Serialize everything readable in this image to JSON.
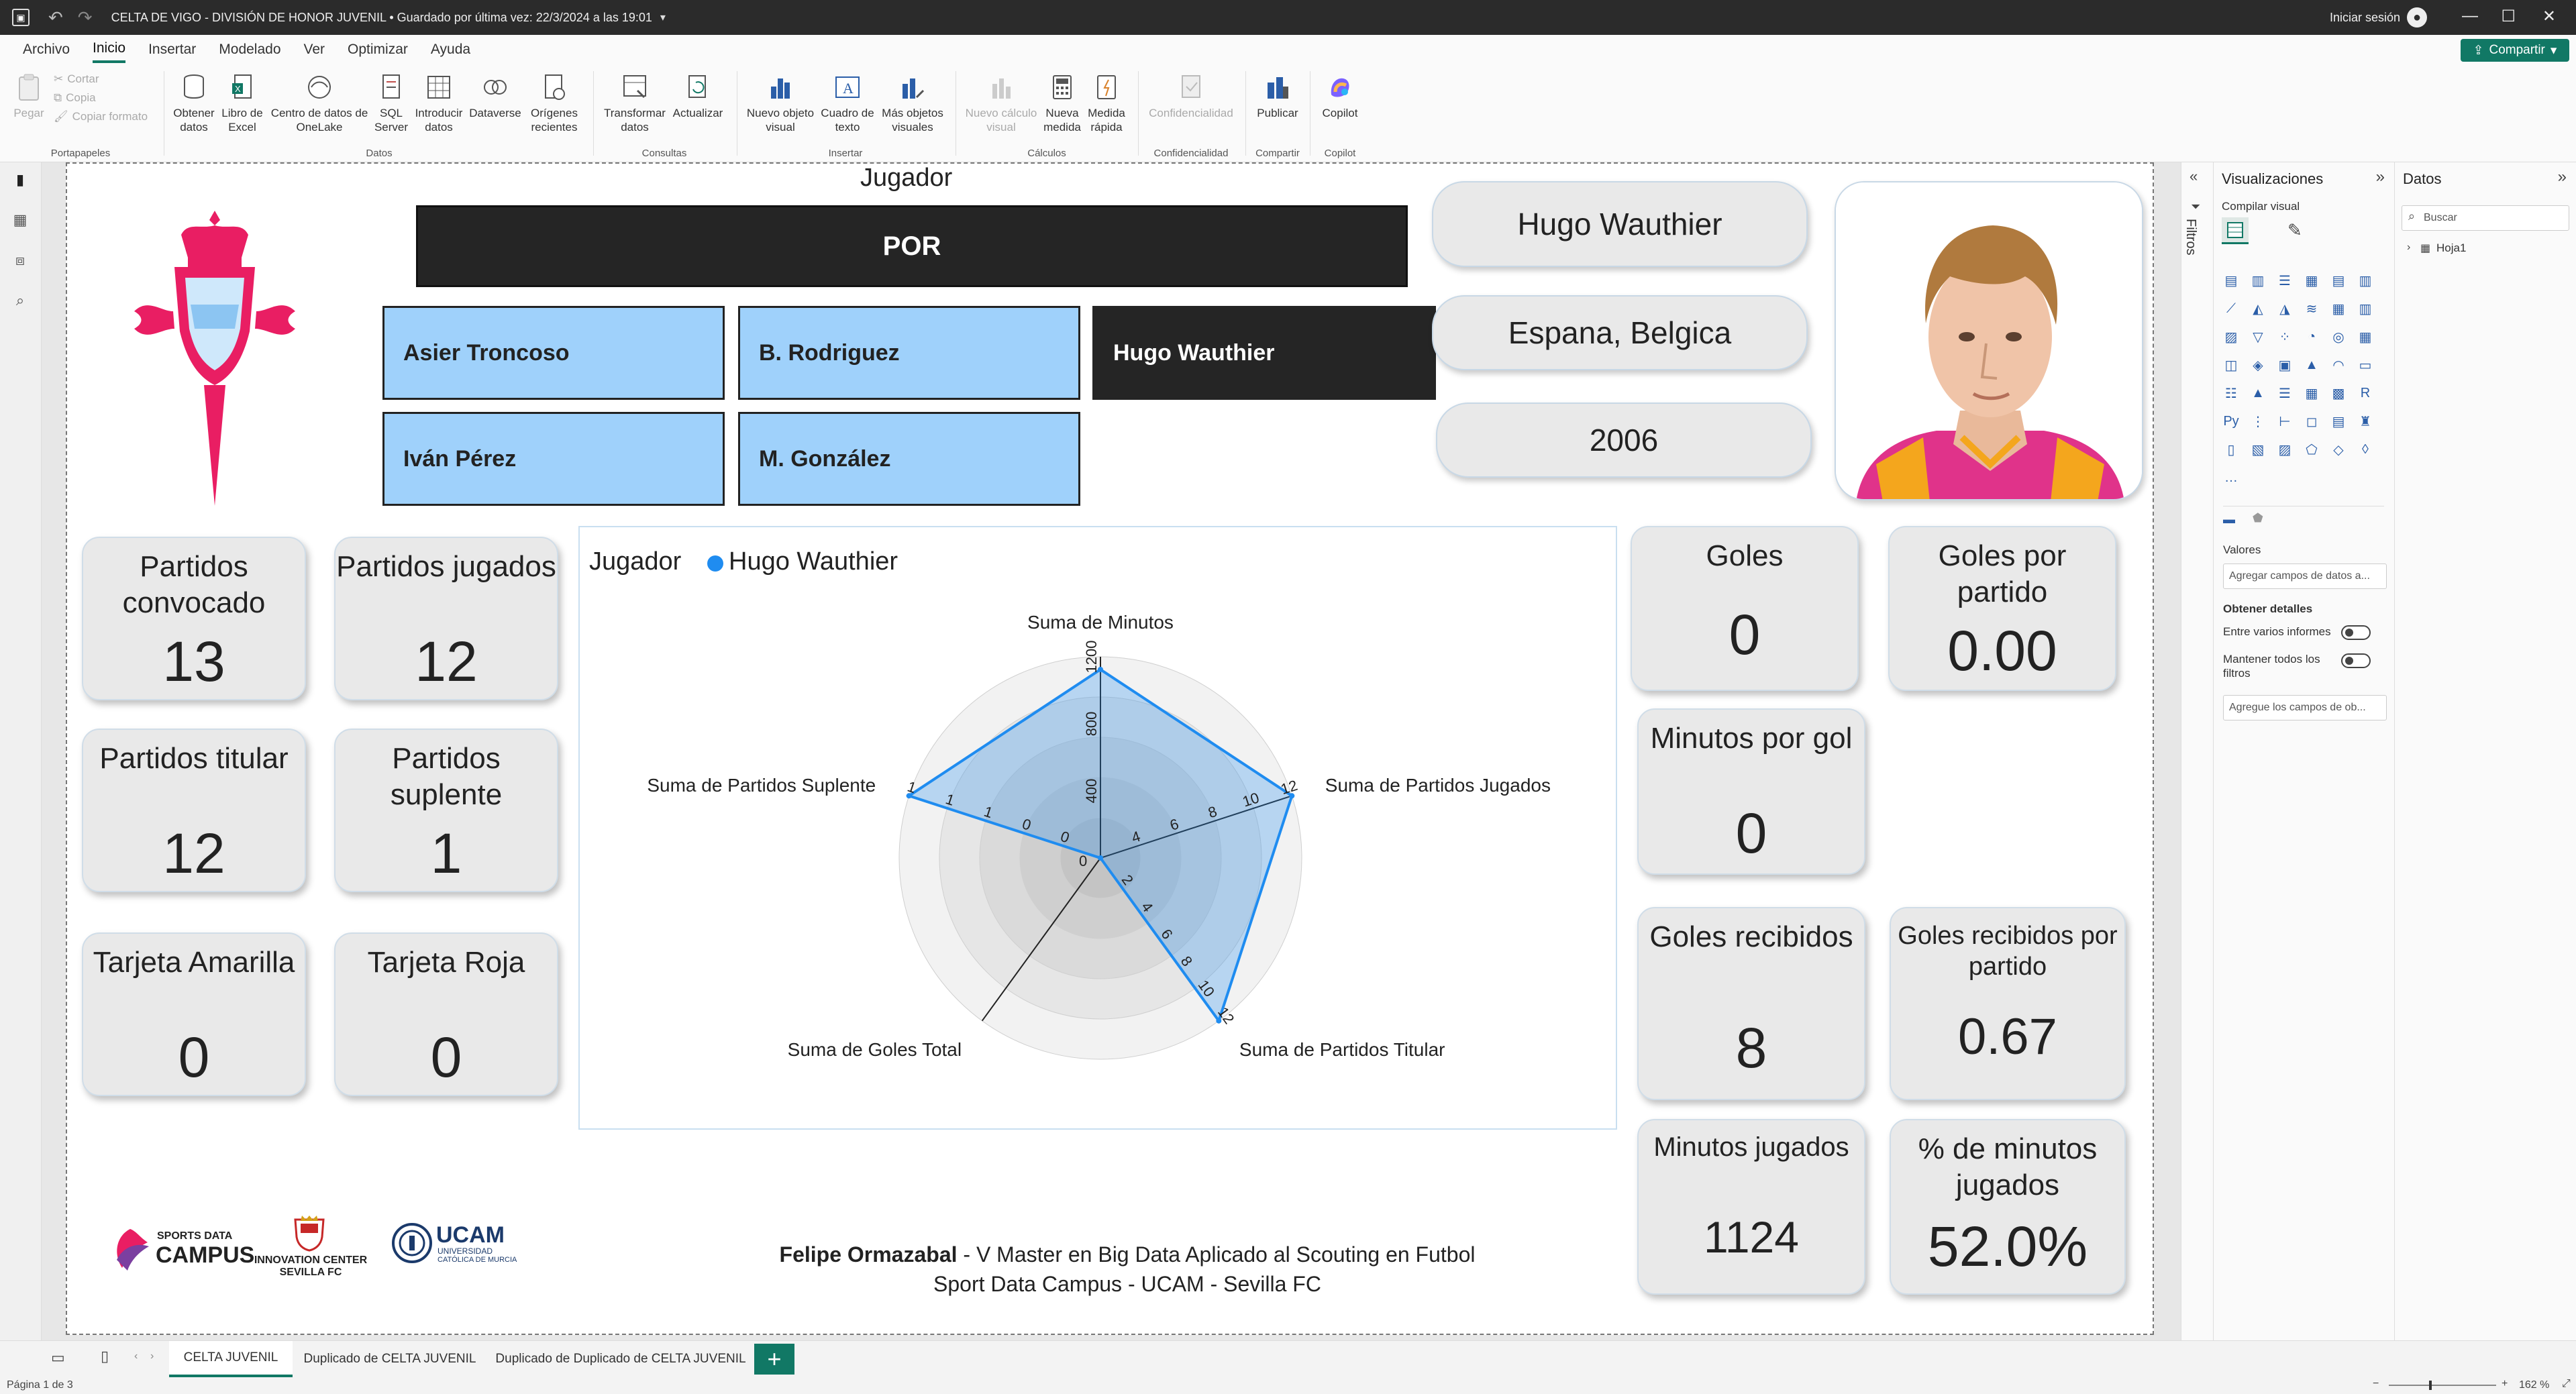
{
  "window": {
    "title": "CELTA DE VIGO - DIVISIÓN DE HONOR JUVENIL • Guardado por última vez: 22/3/2024 a las 19:01",
    "sign_in": "Iniciar sesión"
  },
  "menu": {
    "items": [
      "Archivo",
      "Inicio",
      "Insertar",
      "Modelado",
      "Ver",
      "Optimizar",
      "Ayuda"
    ],
    "active": "Inicio",
    "share_label": "Compartir"
  },
  "ribbon": {
    "clipboard": {
      "paste": "Pegar",
      "cut": "Cortar",
      "copy": "Copia",
      "format": "Copiar formato",
      "group": "Portapapeles"
    },
    "data": {
      "get_data": "Obtener datos",
      "excel": "Libro de Excel",
      "onelake": "Centro de datos de OneLake",
      "sql": "SQL Server",
      "enter_data": "Introducir datos",
      "dataverse": "Dataverse",
      "recent": "Orígenes recientes",
      "group": "Datos"
    },
    "queries": {
      "transform": "Transformar datos",
      "refresh": "Actualizar",
      "group": "Consultas"
    },
    "insert": {
      "new_visual": "Nuevo objeto visual",
      "textbox": "Cuadro de texto",
      "more_visuals": "Más objetos visuales",
      "group": "Insertar"
    },
    "calculations": {
      "new_calc": "Nuevo cálculo visual",
      "new_measure": "Nueva medida",
      "quick_measure": "Medida rápida",
      "group": "Cálculos"
    },
    "sensitivity": {
      "label": "Confidencialidad",
      "group": "Confidencialidad"
    },
    "share": {
      "publish": "Publicar",
      "group": "Compartir"
    },
    "copilot": {
      "label": "Copilot",
      "group": "Copilot"
    }
  },
  "report": {
    "slicer_title": "Jugador",
    "position": "POR",
    "players": [
      "Asier Troncoso",
      "B. Rodriguez",
      "Hugo Wauthier",
      "Iván Pérez",
      "M. González"
    ],
    "selected_player": "Hugo Wauthier",
    "player_name": "Hugo Wauthier",
    "nationality": "Espana, Belgica",
    "birth_year": "2006",
    "cards_left": [
      {
        "label": "Partidos convocado",
        "value": "13"
      },
      {
        "label": "Partidos jugados",
        "value": "12"
      },
      {
        "label": "Partidos titular",
        "value": "12"
      },
      {
        "label": "Partidos suplente",
        "value": "1"
      },
      {
        "label": "Tarjeta Amarilla",
        "value": "0"
      },
      {
        "label": "Tarjeta Roja",
        "value": "0"
      }
    ],
    "cards_right": [
      {
        "label": "Goles",
        "value": "0"
      },
      {
        "label": "Goles por partido",
        "value": "0.00"
      },
      {
        "label": "Minutos por gol",
        "value": "0"
      },
      {
        "label": "Goles recibidos",
        "value": "8"
      },
      {
        "label": "Goles recibidos por partido",
        "value": "0.67"
      },
      {
        "label": "Minutos jugados",
        "value": "1124"
      },
      {
        "label": "% de minutos jugados",
        "value": "52.0%"
      }
    ],
    "footer_author": "Felipe Ormazabal",
    "footer_line1_rest": " - V Master en Big Data Aplicado al Scouting en Futbol",
    "footer_line2": "Sport Data Campus - UCAM - Sevilla FC",
    "logos": {
      "sdc_1": "SPORTS DATA",
      "sdc_2": "CAMPUS",
      "sevilla_1": "INNOVATION CENTER",
      "sevilla_2": "SEVILLA FC",
      "ucam_1": "UCAM",
      "ucam_2": "UNIVERSIDAD",
      "ucam_3": "CATÓLICA DE MURCIA"
    }
  },
  "chart_data": {
    "type": "radar",
    "legend_title": "Jugador",
    "series": [
      {
        "name": "Hugo Wauthier",
        "values": [
          1124,
          12,
          12,
          0,
          1
        ]
      }
    ],
    "axes": [
      {
        "label": "Suma de Minutos",
        "max": 1200,
        "ticks": [
          "400",
          "800",
          "1200"
        ]
      },
      {
        "label": "Suma de Partidos Jugados",
        "max": 12,
        "ticks": [
          "4",
          "6",
          "8",
          "10",
          "12"
        ]
      },
      {
        "label": "Suma de Partidos Titular",
        "max": 12,
        "ticks": [
          "2",
          "4",
          "6",
          "8",
          "10",
          "12"
        ]
      },
      {
        "label": "Suma de Goles Total",
        "max": 1,
        "ticks": []
      },
      {
        "label": "Suma de Partidos Suplente",
        "max": 1,
        "ticks": [
          "0",
          "0",
          "1",
          "1",
          "1"
        ]
      }
    ],
    "center_tick": "0",
    "series_color": "#1f8cf0"
  },
  "panes": {
    "filters": "Filtros",
    "visualizations": "Visualizaciones",
    "build_visual": "Compilar visual",
    "values": "Valores",
    "add_data_fields": "Agregar campos de datos a...",
    "drill_through": "Obtener detalles",
    "cross_report": "Entre varios informes",
    "keep_all_filters": "Mantener todos los filtros",
    "add_drill_fields": "Agregue los campos de ob...",
    "data": "Datos",
    "search_placeholder": "Buscar",
    "table_name": "Hoja1"
  },
  "tabs": [
    "CELTA JUVENIL",
    "Duplicado de CELTA JUVENIL",
    "Duplicado de Duplicado de CELTA JUVENIL"
  ],
  "status": {
    "page": "Página 1 de 3",
    "zoom": "162 %"
  }
}
